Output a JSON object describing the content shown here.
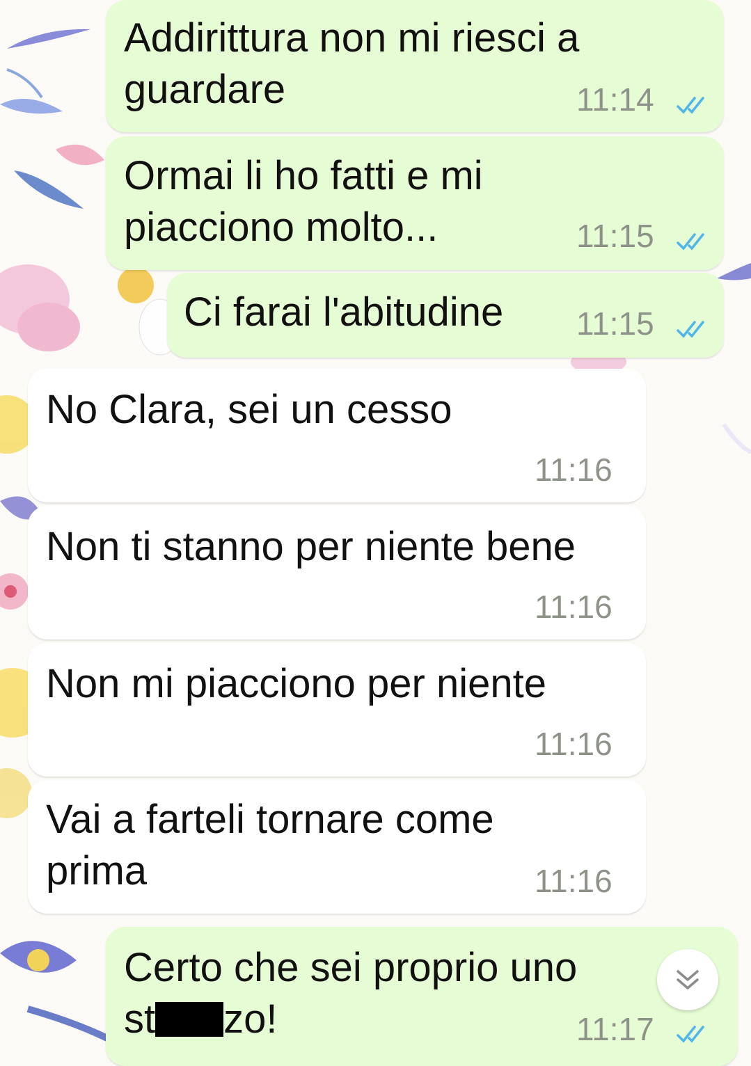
{
  "conversation": {
    "messages": [
      {
        "direction": "outgoing",
        "text_lines": [
          "Addirittura non mi riesci a",
          "guardare"
        ],
        "time": "11:14",
        "status": "read"
      },
      {
        "direction": "outgoing",
        "text_lines": [
          "Ormai li ho fatti e mi",
          "piacciono molto..."
        ],
        "time": "11:15",
        "status": "read"
      },
      {
        "direction": "outgoing",
        "text_lines": [
          "Ci farai l'abitudine"
        ],
        "time": "11:15",
        "status": "read"
      },
      {
        "direction": "incoming",
        "text_lines": [
          "No Clara, sei un cesso"
        ],
        "time": "11:16"
      },
      {
        "direction": "incoming",
        "text_lines": [
          "Non ti stanno per niente bene"
        ],
        "time": "11:16"
      },
      {
        "direction": "incoming",
        "text_lines": [
          "Non mi piacciono per niente"
        ],
        "time": "11:16"
      },
      {
        "direction": "incoming",
        "text_lines": [
          "Vai a farteli tornare come",
          "prima"
        ],
        "time": "11:16"
      },
      {
        "direction": "outgoing",
        "text_lines": [
          "Certo che sei proprio uno",
          "st",
          "zo!"
        ],
        "time": "11:17",
        "status": "read",
        "redacted": true
      }
    ]
  },
  "scroll_button": {
    "icon": "double-chevron-down-icon"
  },
  "colors": {
    "outgoing_bubble": "#e6fcd5",
    "incoming_bubble": "#ffffff",
    "timestamp": "#8e9389",
    "read_ticks": "#4fb6ec"
  }
}
